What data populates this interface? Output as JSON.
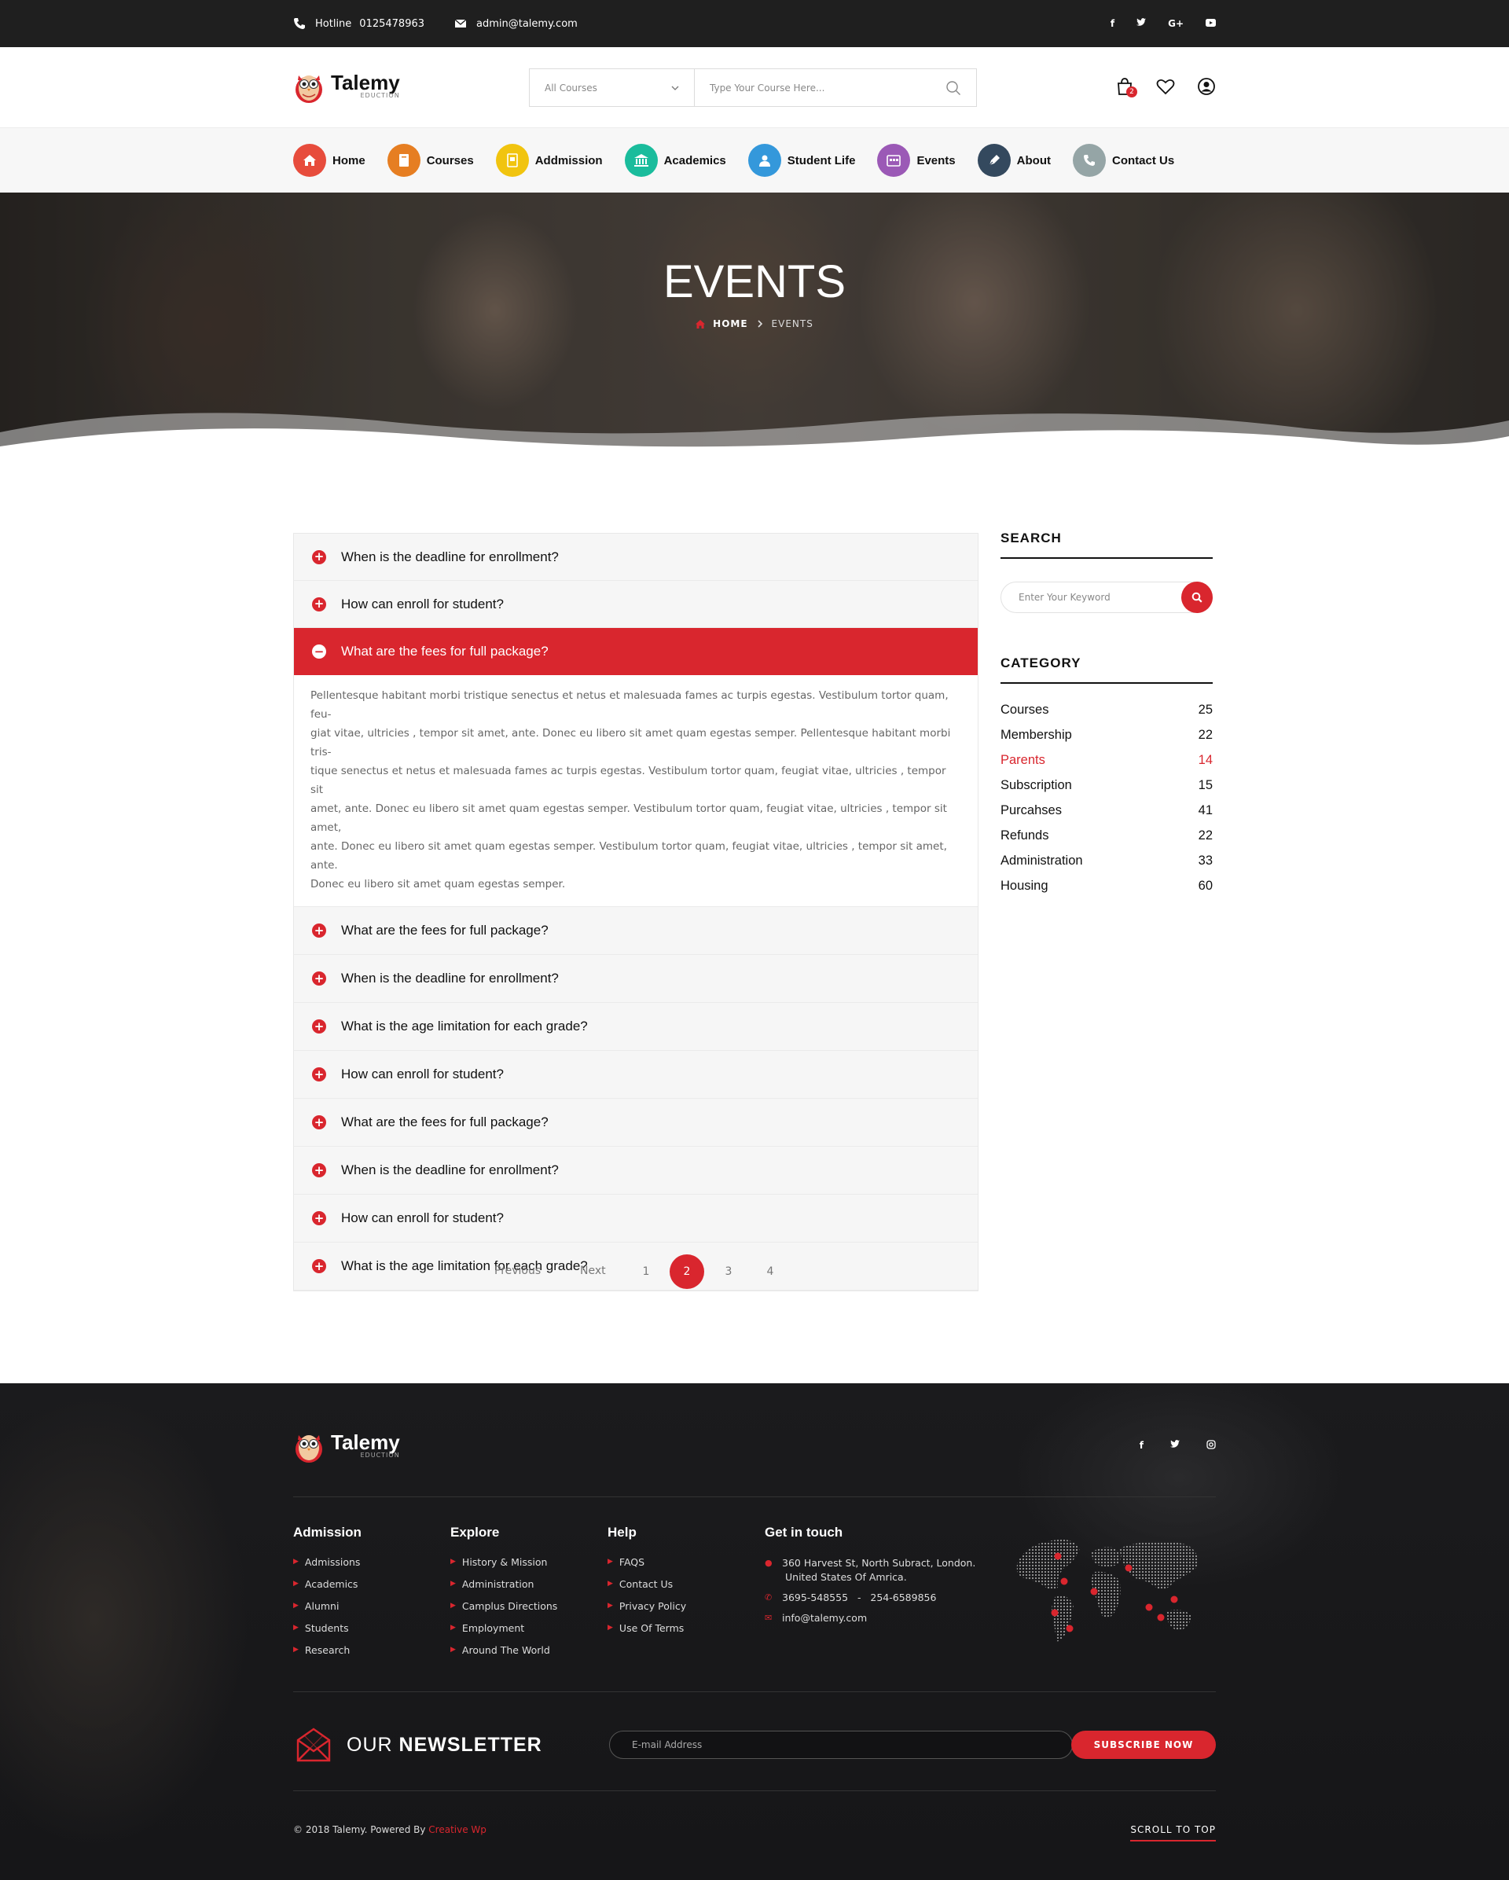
{
  "topbar": {
    "hotline_label": "Hotline",
    "hotline_number": "0125478963",
    "email": "admin@talemy.com",
    "social": [
      "f",
      "t",
      "G+",
      "yt"
    ]
  },
  "brand": {
    "name": "Talemy",
    "tagline": "EDUCTION"
  },
  "search": {
    "category": "All Courses",
    "placeholder": "Type Your Course Here..."
  },
  "cart": {
    "count": "2"
  },
  "nav": {
    "items": [
      {
        "label": "Home",
        "color": "#e74c3c",
        "icon": "home-icon"
      },
      {
        "label": "Courses",
        "color": "#e67e22",
        "icon": "book-icon"
      },
      {
        "label": "Addmission",
        "color": "#f1c40f",
        "icon": "admission-icon"
      },
      {
        "label": "Academics",
        "color": "#1abc9c",
        "icon": "bank-icon"
      },
      {
        "label": "Student Life",
        "color": "#3498db",
        "icon": "user-icon"
      },
      {
        "label": "Events",
        "color": "#9b59b6",
        "icon": "calendar-icon"
      },
      {
        "label": "About",
        "color": "#34495e",
        "icon": "pen-icon"
      },
      {
        "label": "Contact Us",
        "color": "#95a5a6",
        "icon": "phone-icon"
      }
    ]
  },
  "hero": {
    "title": "EVENTS",
    "breadcrumb_home": "HOME",
    "breadcrumb_current": "EVENTS"
  },
  "faq": {
    "items": [
      "When is the deadline for enrollment?",
      "How can enroll for student?",
      "What are the fees for full package?",
      "What are the fees for full package?",
      "When is the deadline for enrollment?",
      "What is the age limitation for each grade?",
      "How can enroll for student?",
      "What are the fees for full package?",
      "When is the deadline for enrollment?",
      "How can enroll for student?",
      "What is the age limitation for each grade?"
    ],
    "answer_lines": [
      "Pellentesque habitant morbi tristique senectus et netus et malesuada fames ac turpis egestas. Vestibulum tortor quam, feu-",
      "giat vitae, ultricies , tempor sit amet, ante. Donec eu libero sit amet quam egestas semper. Pellentesque habitant morbi tris-",
      "tique senectus et netus et malesuada fames ac turpis egestas. Vestibulum tortor quam, feugiat vitae, ultricies , tempor sit",
      "amet, ante. Donec eu libero sit amet quam egestas semper.  Vestibulum tortor quam, feugiat vitae, ultricies , tempor sit amet,",
      "ante. Donec eu libero sit amet quam egestas semper.  Vestibulum tortor quam, feugiat vitae, ultricies , tempor sit amet, ante.",
      "Donec eu libero sit amet quam egestas semper."
    ]
  },
  "sidebar": {
    "search_title": "SEARCH",
    "search_placeholder": "Enter Your Keyword",
    "category_title": "CATEGORY",
    "categories": [
      {
        "name": "Courses",
        "count": "25"
      },
      {
        "name": "Membership",
        "count": "22"
      },
      {
        "name": "Parents",
        "count": "14"
      },
      {
        "name": "Subscription",
        "count": "15"
      },
      {
        "name": "Purcahses",
        "count": "41"
      },
      {
        "name": "Refunds",
        "count": "22"
      },
      {
        "name": "Administration",
        "count": "33"
      },
      {
        "name": "Housing",
        "count": "60"
      }
    ]
  },
  "pagination": {
    "prev": "Previous",
    "next": "Next",
    "pages": [
      "1",
      "2",
      "3",
      "4"
    ],
    "current": "2"
  },
  "footer": {
    "social": [
      "f",
      "t",
      "ig"
    ],
    "admission": {
      "title": "Admission",
      "links": [
        "Admissions",
        "Academics",
        "Alumni",
        "Students",
        "Research"
      ]
    },
    "explore": {
      "title": "Explore",
      "links": [
        "History & Mission",
        "Administration",
        "Camplus Directions",
        "Employment",
        "Around The World"
      ]
    },
    "help": {
      "title": "Help",
      "links": [
        "FAQS",
        "Contact Us",
        "Privacy Policy",
        "Use Of Terms"
      ]
    },
    "contact": {
      "title": "Get in touch",
      "address_line1": "360 Harvest St, North Subract, London.",
      "address_line2": "United States Of Amrica.",
      "phone": "3695-548555   -   254-6589856",
      "email": "info@talemy.com"
    },
    "newsletter": {
      "title_light": "OUR",
      "title_bold": "NEWSLETTER",
      "placeholder": "E-mail Address",
      "button": "SUBSCRIBE NOW"
    },
    "copyright": "© 2018 Talemy.  Powered By",
    "powered_by": "Creative Wp",
    "scroll_top": "SCROLL TO TOP"
  },
  "colors": {
    "accent": "#d9262e",
    "topbar": "#1f1f1f",
    "footer": "#1b1b1d"
  }
}
